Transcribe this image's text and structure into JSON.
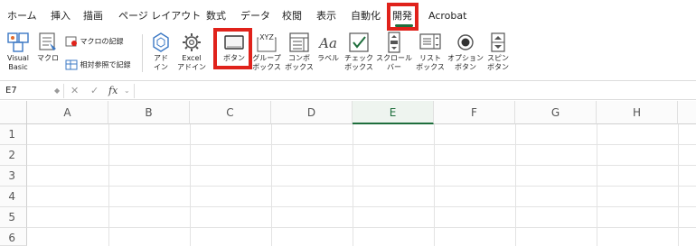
{
  "tabs": [
    "ホーム",
    "挿入",
    "描画",
    "ページ レイアウト",
    "数式",
    "データ",
    "校閲",
    "表示",
    "自動化",
    "開発",
    "Acrobat"
  ],
  "active_tab": "開発",
  "ribbon": {
    "visual_basic": "Visual\nBasic",
    "macro": "マクロ",
    "record_macro": "マクロの記録",
    "relative_refs": "相対参照で記録",
    "addins": "アド\nイン",
    "excel_addins": "Excel\nアドイン",
    "button": "ボタン",
    "group_box": "グループ\nボックス",
    "combo_box": "コンボ\nボックス",
    "label": "ラベル",
    "check_box": "チェック\nボックス",
    "scroll_bar": "スクロール\nバー",
    "list_box": "リスト\nボックス",
    "option_button": "オプション\nボタン",
    "spin_button": "スピン\nボタン",
    "group_box_icon_text": "XYZ",
    "label_icon_text": "Aa"
  },
  "formula_bar": {
    "name_box": "E7",
    "fx": "fx",
    "formula": ""
  },
  "sheet": {
    "columns": [
      "A",
      "B",
      "C",
      "D",
      "E",
      "F",
      "G",
      "H"
    ],
    "selected_column": "E",
    "rows": [
      "1",
      "2",
      "3",
      "4",
      "5",
      "6"
    ]
  },
  "colors": {
    "accent": "#1e6e3c",
    "highlight": "#e0221b"
  }
}
